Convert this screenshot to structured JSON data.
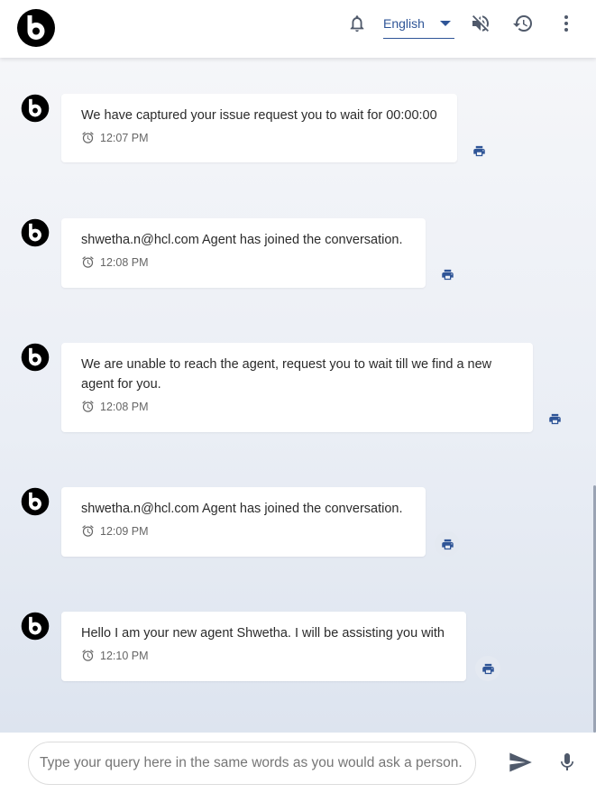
{
  "header": {
    "language": "English",
    "icons": [
      "logo-icon",
      "bell-icon",
      "chevron-down-icon",
      "volume-off-icon",
      "history-icon",
      "more-vert-icon"
    ]
  },
  "messages": [
    {
      "text": "We have captured your issue request you to wait for 00:00:00",
      "time": "12:07 PM"
    },
    {
      "text": "shwetha.n@hcl.com Agent has joined the conversation.",
      "time": "12:08 PM"
    },
    {
      "text": "We are unable to reach the agent, request you to wait till we find a new agent for you.",
      "time": "12:08 PM"
    },
    {
      "text": "shwetha.n@hcl.com Agent has joined the conversation.",
      "time": "12:09 PM"
    },
    {
      "text": "Hello I am your new agent Shwetha. I will be assisting you with",
      "time": "12:10 PM"
    }
  ],
  "footer": {
    "placeholder": "Type your query here in the same words as you would ask a person."
  },
  "colors": {
    "accent": "#2f5597",
    "icon": "#505a6b",
    "logo": "#000000"
  }
}
